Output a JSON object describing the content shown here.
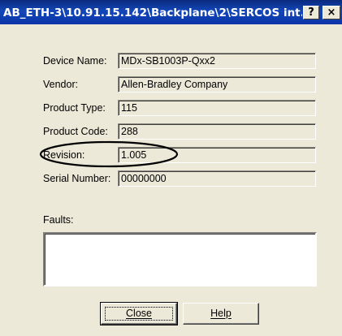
{
  "window": {
    "title": "AB_ETH-3\\10.91.15.142\\Backplane\\2\\SERCOS int...",
    "help_button": "?",
    "close_button": "×"
  },
  "fields": [
    {
      "label": "Device Name:",
      "value": "MDx-SB1003P-Qxx2"
    },
    {
      "label": "Vendor:",
      "value": "Allen-Bradley Company"
    },
    {
      "label": "Product Type:",
      "value": "115"
    },
    {
      "label": "Product Code:",
      "value": "288"
    },
    {
      "label": "Revision:",
      "value": "1.005"
    },
    {
      "label": "Serial Number:",
      "value": "00000000"
    }
  ],
  "faults": {
    "label": "Faults:",
    "value": ""
  },
  "buttons": {
    "close_label": "Close",
    "help_label": "Help"
  },
  "colors": {
    "titlebar": "#0a35a8",
    "dialog_bg": "#ece9d8",
    "annotation": "#000000"
  }
}
